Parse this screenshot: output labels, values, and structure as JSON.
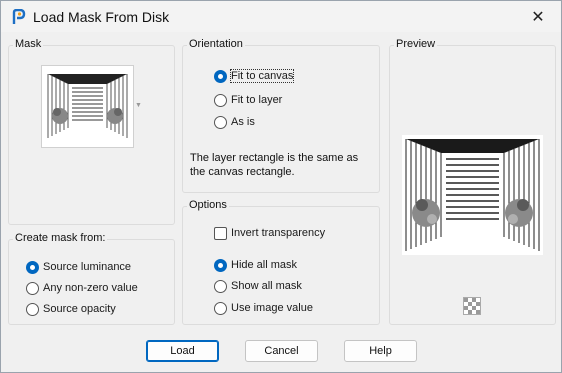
{
  "window": {
    "title": "Load Mask From Disk",
    "close_icon": "close-icon",
    "app_icon": "paintshop-logo-icon"
  },
  "mask_group": {
    "label": "Mask"
  },
  "create_mask_group": {
    "label": "Create mask from:",
    "options": [
      {
        "label": "Source luminance",
        "selected": true
      },
      {
        "label": "Any non-zero value",
        "selected": false
      },
      {
        "label": "Source opacity",
        "selected": false
      }
    ]
  },
  "orientation_group": {
    "label": "Orientation",
    "options": [
      {
        "label": "Fit to canvas",
        "selected": true
      },
      {
        "label": "Fit to layer",
        "selected": false
      },
      {
        "label": "As is",
        "selected": false
      }
    ],
    "description": "The layer rectangle is the same as the canvas rectangle."
  },
  "options_group": {
    "label": "Options",
    "invert_label": "Invert transparency",
    "invert_checked": false,
    "mask_options": [
      {
        "label": "Hide all mask",
        "selected": true
      },
      {
        "label": "Show all mask",
        "selected": false
      },
      {
        "label": "Use image value",
        "selected": false
      }
    ]
  },
  "preview_group": {
    "label": "Preview",
    "background_toggle_icon": "checkerboard-icon"
  },
  "buttons": {
    "load": "Load",
    "cancel": "Cancel",
    "help": "Help"
  },
  "colors": {
    "accent": "#0067c0",
    "background": "#f0f0f0"
  }
}
